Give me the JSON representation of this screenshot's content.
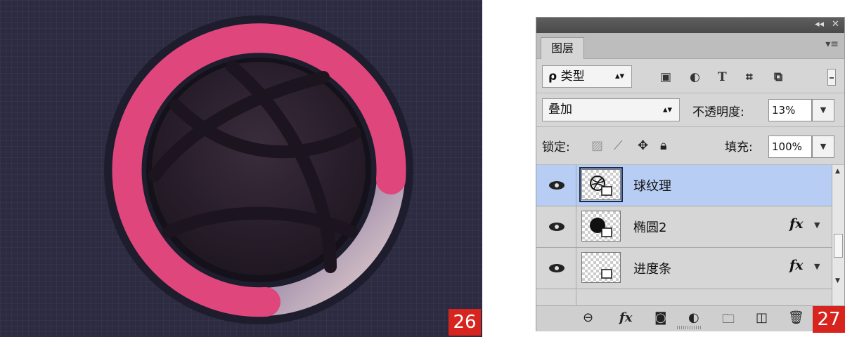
{
  "badges": {
    "left": "26",
    "right": "27"
  },
  "panel": {
    "window_controls": {
      "collapse": "◂◂",
      "close": "✕"
    },
    "tab_label": "图层",
    "menu_icon": "panel-menu-icon",
    "filter": {
      "label": "类型",
      "search_glyph": "ρ",
      "icons": [
        "image-filter-icon",
        "adjustment-filter-icon",
        "type-filter-icon",
        "shape-filter-icon",
        "smart-object-filter-icon"
      ],
      "type_glyph": "T"
    },
    "blend_mode": "叠加",
    "opacity_label": "不透明度:",
    "opacity_value": "13%",
    "lock_label": "锁定:",
    "fill_label": "填充:",
    "fill_value": "100%",
    "layers": [
      {
        "name": "球纹理",
        "selected": true,
        "visible": true,
        "fx": ""
      },
      {
        "name": "椭圆2",
        "selected": false,
        "visible": true,
        "fx": "fx"
      },
      {
        "name": "进度条",
        "selected": false,
        "visible": true,
        "fx": "fx"
      }
    ],
    "bottom_icons": [
      "link-icon",
      "fx-icon",
      "mask-icon",
      "adjustment-icon",
      "folder-icon",
      "new-layer-icon",
      "trash-icon"
    ],
    "bottom_fx_label": "fx"
  },
  "colors": {
    "background": "#2c2b41",
    "ring_pink": "#e04a7e",
    "ring_track": "#8b7aa8",
    "ball": "#2a1f2c",
    "badge": "#d8241e",
    "selected_layer": "#b7cdf3"
  }
}
